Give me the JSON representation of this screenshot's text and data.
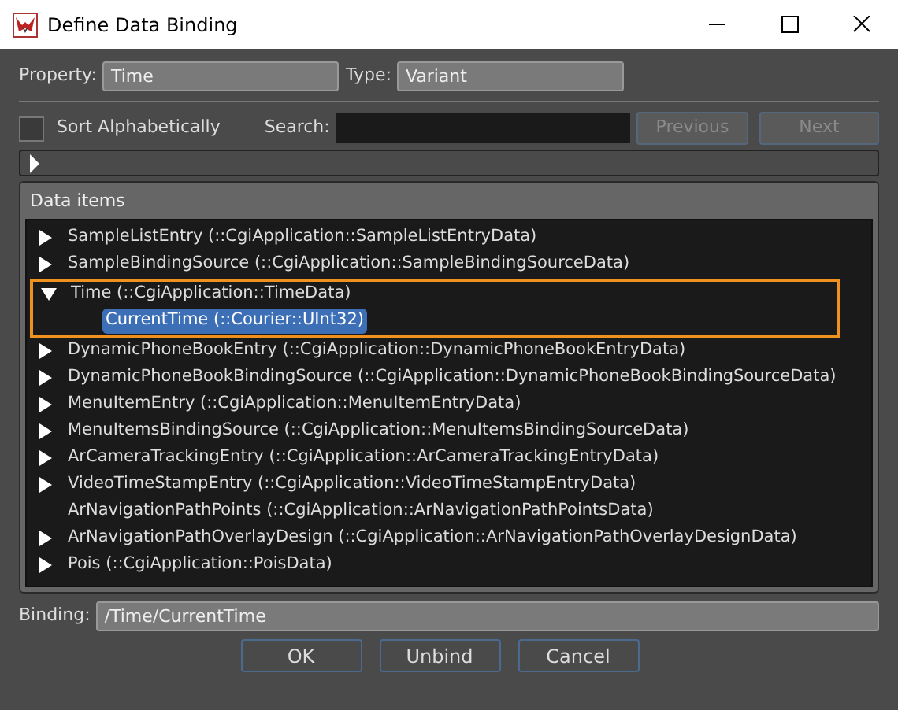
{
  "window": {
    "title": "Define Data Binding"
  },
  "property": {
    "label": "Property:",
    "value": "Time"
  },
  "type": {
    "label": "Type:",
    "value": "Variant"
  },
  "sort": {
    "label": "Sort Alphabetically",
    "checked": false
  },
  "search": {
    "label": "Search:"
  },
  "nav_buttons": [
    {
      "label": "Previous",
      "disabled": true
    },
    {
      "label": "Next",
      "disabled": true
    }
  ],
  "collapsed_bar": {
    "expanded": false
  },
  "data_items": {
    "title": "Data items",
    "items": [
      {
        "label": "SampleListEntry (::CgiApplication::SampleListEntryData)",
        "kind": "branch",
        "expanded": false,
        "selected": false,
        "focused": false
      },
      {
        "label": "SampleBindingSource (::CgiApplication::SampleBindingSourceData)",
        "kind": "branch",
        "expanded": false,
        "selected": false,
        "focused": false
      },
      {
        "label": "Time (::CgiApplication::TimeData)",
        "kind": "branch",
        "expanded": true,
        "selected": false,
        "focused": true,
        "children": [
          {
            "label": "CurrentTime (::Courier::UInt32)",
            "kind": "leaf",
            "selected": true
          }
        ]
      },
      {
        "label": "DynamicPhoneBookEntry (::CgiApplication::DynamicPhoneBookEntryData)",
        "kind": "branch",
        "expanded": false,
        "selected": false,
        "focused": false
      },
      {
        "label": "DynamicPhoneBookBindingSource (::CgiApplication::DynamicPhoneBookBindingSourceData)",
        "kind": "branch",
        "expanded": false,
        "selected": false,
        "focused": false
      },
      {
        "label": "MenuItemEntry (::CgiApplication::MenuItemEntryData)",
        "kind": "branch",
        "expanded": false,
        "selected": false,
        "focused": false
      },
      {
        "label": "MenuItemsBindingSource (::CgiApplication::MenuItemsBindingSourceData)",
        "kind": "branch",
        "expanded": false,
        "selected": false,
        "focused": false
      },
      {
        "label": "ArCameraTrackingEntry (::CgiApplication::ArCameraTrackingEntryData)",
        "kind": "branch",
        "expanded": false,
        "selected": false,
        "focused": false
      },
      {
        "label": "VideoTimeStampEntry (::CgiApplication::VideoTimeStampEntryData)",
        "kind": "branch",
        "expanded": false,
        "selected": false,
        "focused": false
      },
      {
        "label": "ArNavigationPathPoints (::CgiApplication::ArNavigationPathPointsData)",
        "kind": "leaf",
        "selected": false,
        "focused": false
      },
      {
        "label": "ArNavigationPathOverlayDesign (::CgiApplication::ArNavigationPathOverlayDesignData)",
        "kind": "branch",
        "expanded": false,
        "selected": false,
        "focused": false
      },
      {
        "label": "Pois (::CgiApplication::PoisData)",
        "kind": "branch",
        "expanded": false,
        "selected": false,
        "focused": false
      }
    ]
  },
  "binding": {
    "label": "Binding:",
    "value": "/Time/CurrentTime"
  },
  "buttons": [
    "OK",
    "Unbind",
    "Cancel"
  ]
}
